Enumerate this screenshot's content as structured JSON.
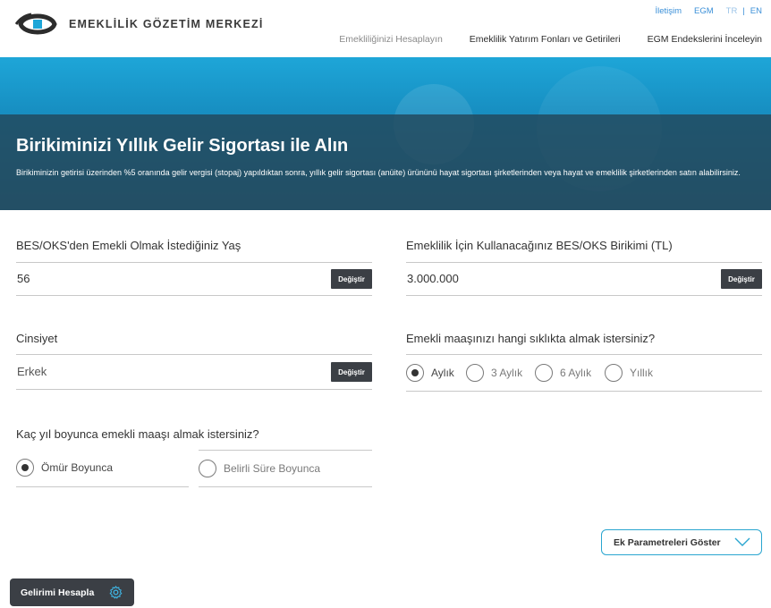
{
  "header": {
    "brand": "EMEKLİLİK GÖZETİM MERKEZİ",
    "top_links": {
      "contact": "İletişim",
      "egm": "EGM",
      "lang_tr": "TR",
      "lang_sep": "|",
      "lang_en": "EN"
    },
    "nav": [
      {
        "label": "Emekliliğinizi Hesaplayın"
      },
      {
        "label": "Emeklilik Yatırım Fonları ve Getirileri"
      },
      {
        "label": "EGM Endekslerini İnceleyin"
      }
    ]
  },
  "hero": {
    "title": "Birikiminizi Yıllık Gelir Sigortası ile Alın",
    "description": "Birikiminizin getirisi üzerinden %5 oranında gelir vergisi (stopaj) yapıldıktan sonra, yıllık gelir sigortası (anüite) ürününü hayat sigortası şirketlerinden veya hayat ve emeklilik şirketlerinden satın alabilirsiniz."
  },
  "form": {
    "age": {
      "label": "BES/OKS'den Emekli Olmak İstediğiniz Yaş",
      "value": "56",
      "button": "Değiştir"
    },
    "savings": {
      "label": "Emeklilik İçin Kullanacağınız BES/OKS Birikimi (TL)",
      "value": "3.000.000",
      "button": "Değiştir"
    },
    "gender": {
      "label": "Cinsiyet",
      "value": "Erkek",
      "button": "Değiştir"
    },
    "frequency": {
      "label": "Emekli maaşınızı hangi sıklıkta almak istersiniz?",
      "options": [
        "Aylık",
        "3 Aylık",
        "6 Aylık",
        "Yıllık"
      ],
      "selected": "Aylık"
    },
    "duration": {
      "label": "Kaç yıl boyunca emekli maaşı almak istersiniz?",
      "options": [
        "Ömür Boyunca",
        "Belirli Süre Boyunca"
      ],
      "selected": "Ömür Boyunca"
    }
  },
  "actions": {
    "extra_params": "Ek Parametreleri Göster",
    "calculate": "Gelirimi Hesapla"
  },
  "colors": {
    "accent": "#2aa6d0",
    "dark_button": "#3b3f45",
    "link": "#3a8fd8",
    "hero_band": "#22485c"
  },
  "icons": {
    "logo": "egm-logo-icon",
    "chevron": "chevron-down-icon",
    "gear": "gear-icon"
  }
}
